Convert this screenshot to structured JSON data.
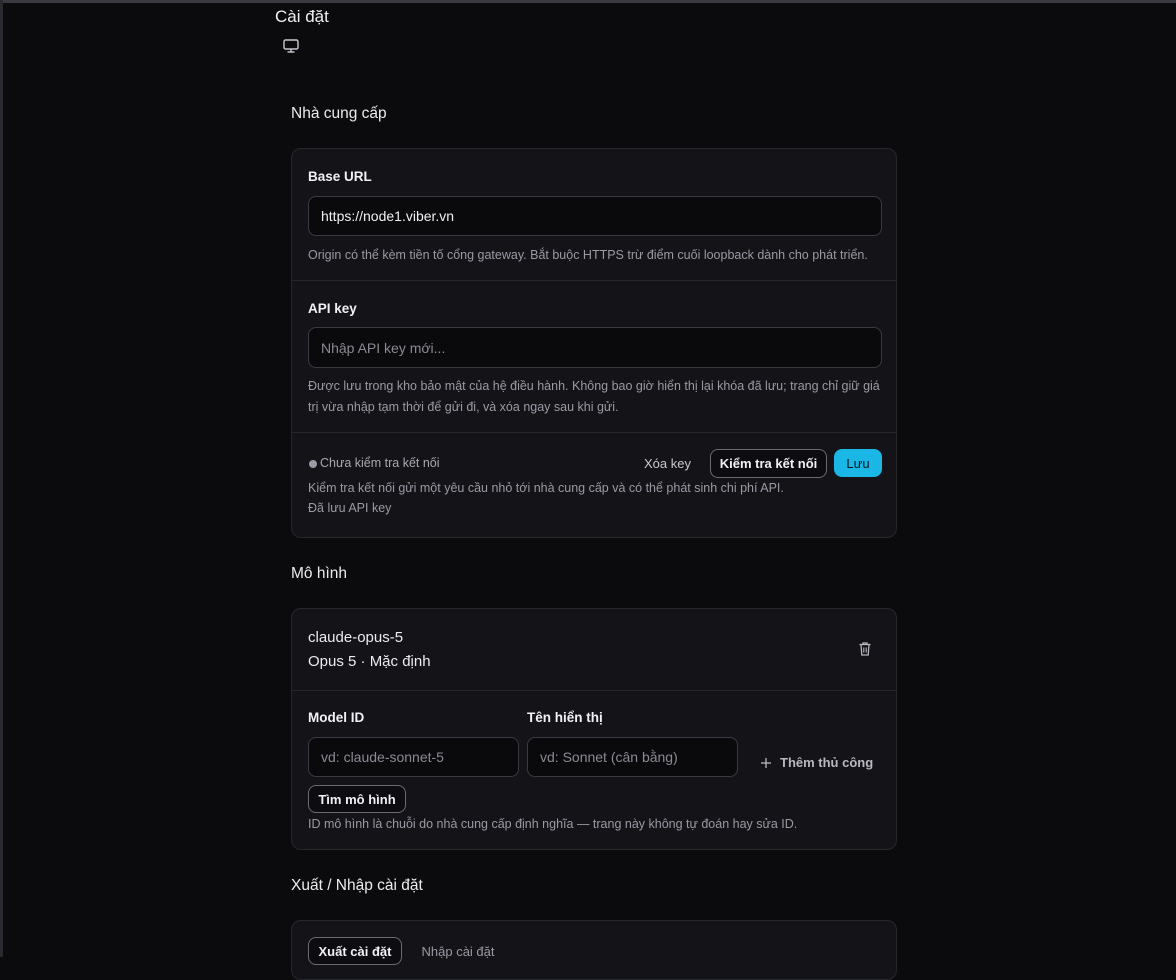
{
  "page": {
    "title": "Cài đặt",
    "icon": "monitor-icon"
  },
  "provider": {
    "section_title": "Nhà cung cấp",
    "base_url": {
      "label": "Base URL",
      "value": "https://node1.viber.vn",
      "help": "Origin có thể kèm tiền tố cổng gateway. Bắt buộc HTTPS trừ điểm cuối loopback dành cho phát triển."
    },
    "api_key": {
      "label": "API key",
      "placeholder": "Nhập API key mới...",
      "help_line1": "Được lưu trong kho bảo mật của hệ điều hành. Không bao giờ hiển thị lại khóa đã lưu; trang chỉ giữ giá",
      "help_line2": "trị vừa nhập tạm thời để gửi đi, và xóa ngay sau khi gửi."
    },
    "status": {
      "text": "Chưa kiểm tra kết nối",
      "note1": "Kiểm tra kết nối gửi một yêu cầu nhỏ tới nhà cung cấp và có thể phát sinh chi phí API.",
      "note2": "Đã lưu API key"
    },
    "buttons": {
      "delete_key": "Xóa key",
      "test_connection": "Kiểm tra kết nối",
      "save": "Lưu"
    }
  },
  "models": {
    "section_title": "Mô hình",
    "items": [
      {
        "id": "claude-opus-5",
        "subtitle": "Opus 5 · Mặc định"
      }
    ],
    "form": {
      "model_id_label": "Model ID",
      "model_id_placeholder": "vd: claude-sonnet-5",
      "display_name_label": "Tên hiển thị",
      "display_name_placeholder": "vd: Sonnet (cân bằng)",
      "add_manual": "Thêm thủ công",
      "find_models": "Tìm mô hình",
      "help": "ID mô hình là chuỗi do nhà cung cấp định nghĩa — trang này không tự đoán hay sửa ID."
    }
  },
  "export_import": {
    "section_title": "Xuất / Nhập cài đặt",
    "tabs": [
      {
        "label": "Xuất cài đặt",
        "active": true
      },
      {
        "label": "Nhập cài đặt",
        "active": false
      }
    ]
  },
  "colors": {
    "background": "#0b0b0e",
    "card": "#131318",
    "accent": "#19b6e6"
  }
}
